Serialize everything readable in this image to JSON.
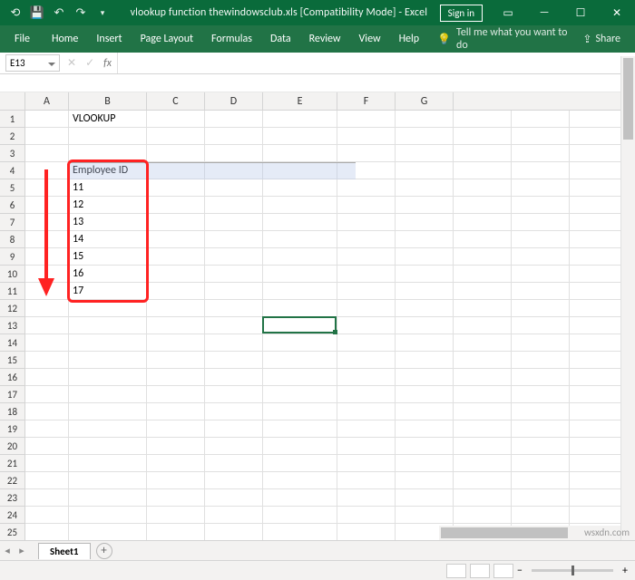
{
  "titlebar": {
    "filename": "vlookup function thewindowsclub.xls  [Compatibility Mode]  -  Excel",
    "signin": "Sign in"
  },
  "ribbon": {
    "file": "File",
    "tabs": [
      "Home",
      "Insert",
      "Page Layout",
      "Formulas",
      "Data",
      "Review",
      "View",
      "Help"
    ],
    "tellme": "Tell me what you want to do",
    "share": "Share"
  },
  "namebox": "E13",
  "fxlabel": "fx",
  "columns": [
    "A",
    "B",
    "C",
    "D",
    "E",
    "F",
    "G"
  ],
  "rows_count": 27,
  "cells": {
    "B1": "VLOOKUP",
    "B4": "Employee ID",
    "B5": "11",
    "B6": "12",
    "B7": "13",
    "B8": "14",
    "B9": "15",
    "B10": "16",
    "B11": "17"
  },
  "selection": {
    "ref": "B4:F4"
  },
  "active_cell": "E13",
  "sheet_tab": "Sheet1",
  "watermark": "wsxdn.com",
  "zoom_minus": "−",
  "zoom_plus": "+",
  "colors": {
    "excel_green": "#217346",
    "title_green": "#0a6b3b"
  }
}
